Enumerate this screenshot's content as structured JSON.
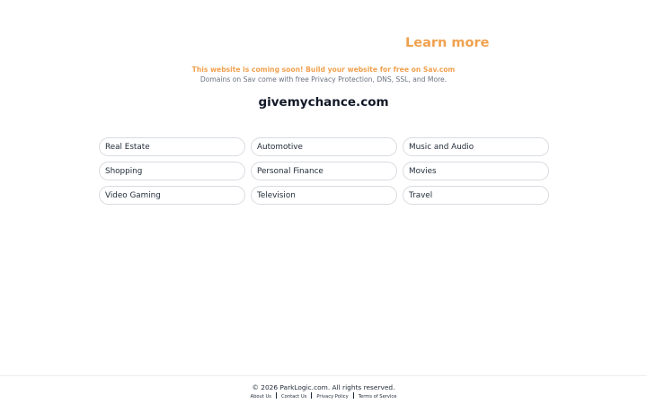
{
  "header": {
    "learn_more": "Learn more"
  },
  "promo": {
    "headline": "This website is coming soon! Build your website for free on Sav.com",
    "subtext": "Domains on Sav come with free Privacy Protection, DNS, SSL, and More."
  },
  "domain": {
    "name": "givemychance.com"
  },
  "categories": [
    "Real Estate",
    "Automotive",
    "Music and Audio",
    "Shopping",
    "Personal Finance",
    "Movies",
    "Video Gaming",
    "Television",
    "Travel"
  ],
  "footer": {
    "copyright": "© 2026 ParkLogic.com. All rights reserved.",
    "links": [
      "About Us",
      "Contact Us",
      "Privacy Policy",
      "Terms of Service"
    ]
  },
  "colors": {
    "accent": "#f0a14e",
    "muted_text": "#6b7280",
    "pill_border": "#d7dbe0"
  }
}
